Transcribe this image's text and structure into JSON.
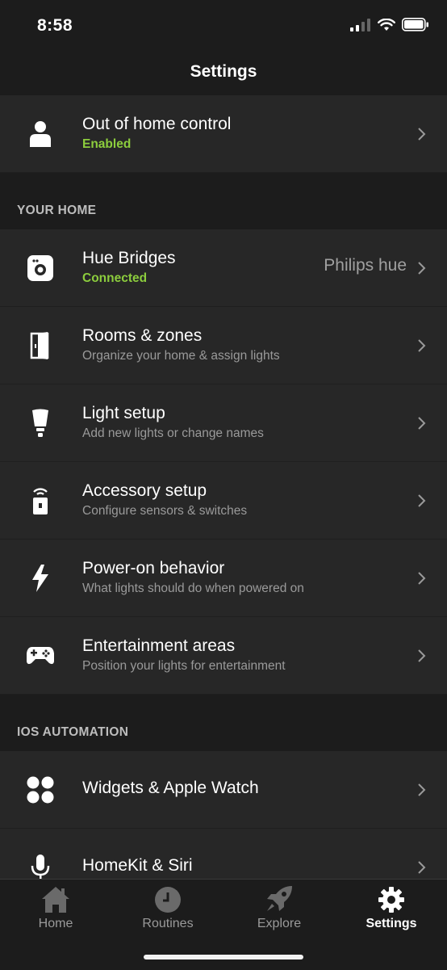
{
  "status_bar": {
    "time": "8:58"
  },
  "header": {
    "title": "Settings"
  },
  "top_item": {
    "icon": "person-icon",
    "title": "Out of home control",
    "subtitle": "Enabled"
  },
  "sections": [
    {
      "label": "YOUR HOME"
    },
    {
      "label": "IOS AUTOMATION"
    }
  ],
  "home_items": [
    {
      "icon": "bridge-icon",
      "title": "Hue Bridges",
      "subtitle": "Connected",
      "value": "Philips hue"
    },
    {
      "icon": "door-icon",
      "title": "Rooms & zones",
      "subtitle": "Organize your home & assign lights"
    },
    {
      "icon": "bulb-icon",
      "title": "Light setup",
      "subtitle": "Add new lights or change names"
    },
    {
      "icon": "remote-icon",
      "title": "Accessory setup",
      "subtitle": "Configure sensors & switches"
    },
    {
      "icon": "lightning-icon",
      "title": "Power-on behavior",
      "subtitle": "What lights should do when powered on"
    },
    {
      "icon": "gamepad-icon",
      "title": "Entertainment areas",
      "subtitle": "Position your lights for entertainment"
    }
  ],
  "automation_items": [
    {
      "icon": "widgets-icon",
      "title": "Widgets & Apple Watch"
    },
    {
      "icon": "microphone-icon",
      "title": "HomeKit & Siri"
    }
  ],
  "tabs": [
    {
      "label": "Home",
      "icon": "house-icon",
      "active": false
    },
    {
      "label": "Routines",
      "icon": "clock-icon",
      "active": false
    },
    {
      "label": "Explore",
      "icon": "rocket-icon",
      "active": false
    },
    {
      "label": "Settings",
      "icon": "gear-icon",
      "active": true
    }
  ],
  "colors": {
    "background": "#1c1c1c",
    "row": "#272727",
    "success": "#8ccd3d",
    "muted": "#9a9a9a"
  }
}
